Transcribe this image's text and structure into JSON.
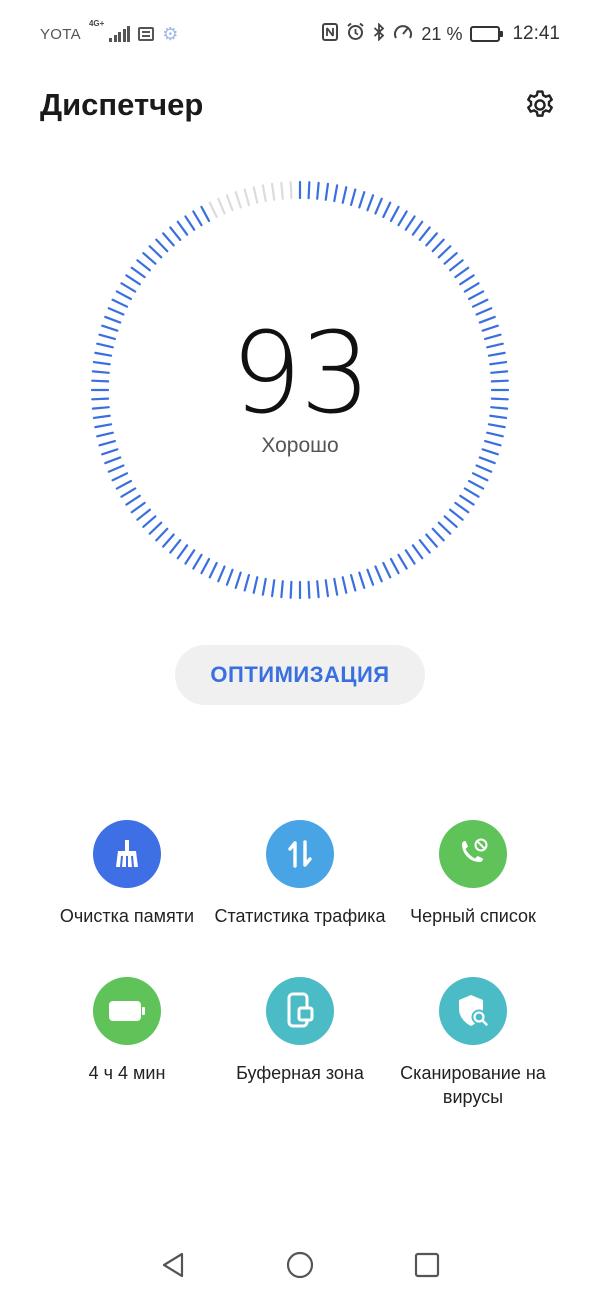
{
  "status_bar": {
    "carrier": "YOTA",
    "network": "4G+",
    "battery_percent": "21 %",
    "battery_level": 0.21,
    "time": "12:41",
    "icons": [
      "signal-icon",
      "message-icon",
      "settings-gear-icon",
      "nfc-icon",
      "alarm-icon",
      "bluetooth-icon",
      "speed-icon",
      "battery-icon"
    ]
  },
  "header": {
    "title": "Диспетчер",
    "settings_icon": "gear-icon"
  },
  "score": {
    "value": "93",
    "level": 0.93,
    "label": "Хорошо",
    "accent_color": "#3a6fe0",
    "inactive_color": "#dcdcdc"
  },
  "optimize": {
    "label": "ОПТИМИЗАЦИЯ"
  },
  "tools": [
    {
      "label": "Очистка памяти",
      "icon": "broom-icon",
      "color": "#3f6fe5"
    },
    {
      "label": "Статистика трафика",
      "icon": "traffic-arrows-icon",
      "color": "#49a4e6"
    },
    {
      "label": "Черный список",
      "icon": "blocked-call-icon",
      "color": "#5fc35a"
    },
    {
      "label": "4 ч 4 мин",
      "icon": "battery-icon",
      "color": "#5fc35a"
    },
    {
      "label": "Буферная зона",
      "icon": "phone-window-icon",
      "color": "#4bbcc6"
    },
    {
      "label": "Сканирование на вирусы",
      "icon": "shield-search-icon",
      "color": "#4bbcc6"
    }
  ],
  "nav": {
    "back_icon": "back-triangle-icon",
    "home_icon": "home-circle-icon",
    "recents_icon": "recents-square-icon"
  }
}
